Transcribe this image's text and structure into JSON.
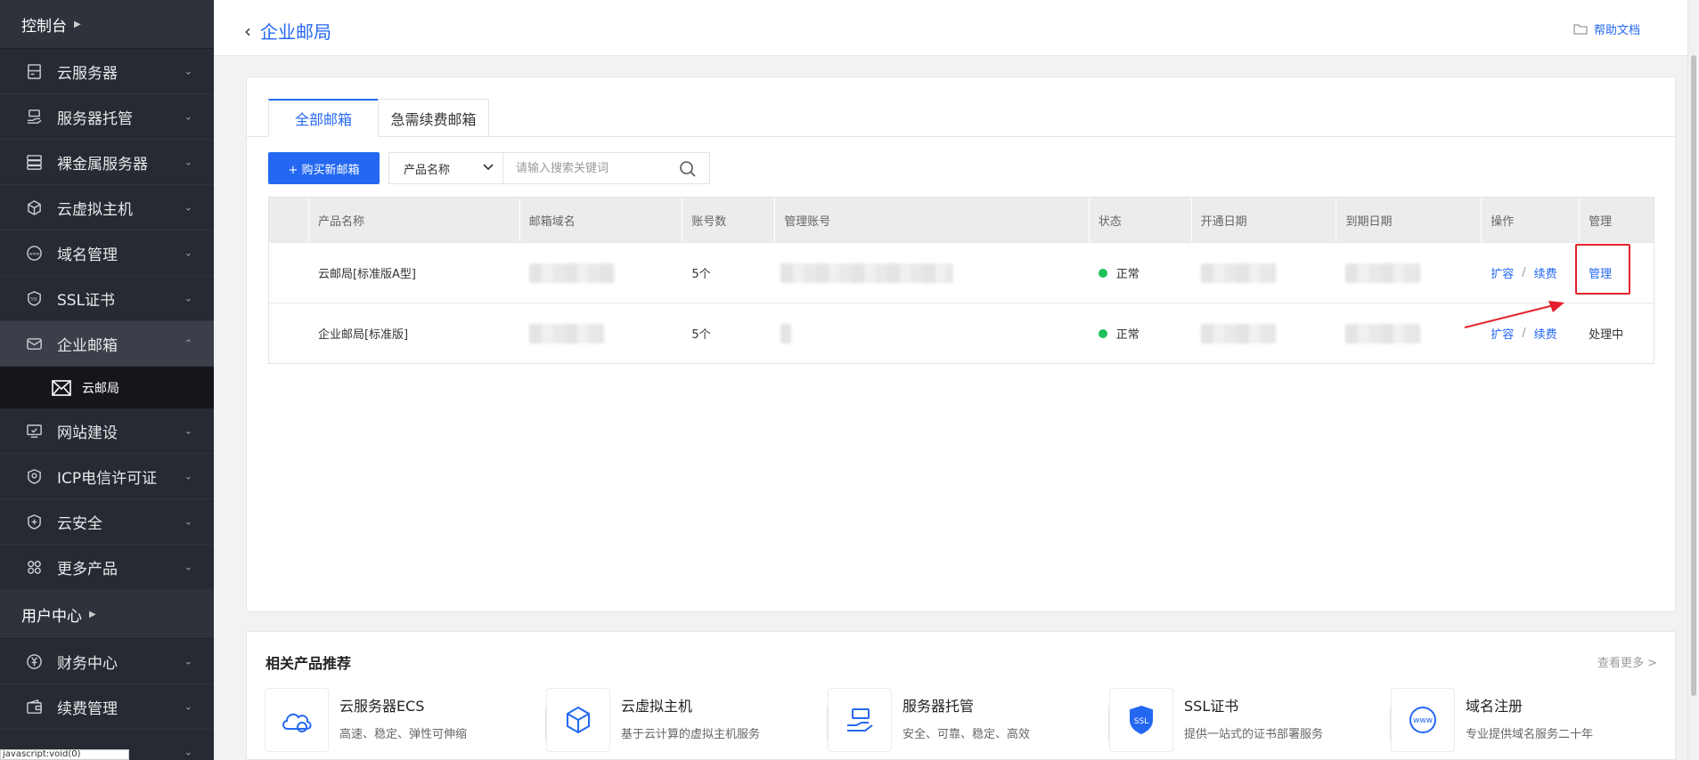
{
  "sidebar": {
    "console_label": "控制台",
    "items": [
      {
        "label": "云服务器",
        "icon": "server-icon"
      },
      {
        "label": "服务器托管",
        "icon": "hosting-icon"
      },
      {
        "label": "裸金属服务器",
        "icon": "bare-metal-icon"
      },
      {
        "label": "云虚拟主机",
        "icon": "cube-icon"
      },
      {
        "label": "域名管理",
        "icon": "www-icon"
      },
      {
        "label": "SSL证书",
        "icon": "ssl-icon"
      },
      {
        "label": "企业邮箱",
        "icon": "mail-icon"
      }
    ],
    "sub_item": {
      "label": "云邮局",
      "icon": "mail-icon"
    },
    "items2": [
      {
        "label": "网站建设",
        "icon": "website-icon"
      },
      {
        "label": "ICP电信许可证",
        "icon": "license-icon"
      },
      {
        "label": "云安全",
        "icon": "shield-icon"
      },
      {
        "label": "更多产品",
        "icon": "grid-icon"
      }
    ],
    "user_center_label": "用户中心",
    "items3": [
      {
        "label": "财务中心",
        "icon": "yen-icon"
      },
      {
        "label": "续费管理",
        "icon": "wallet-icon"
      }
    ],
    "status_tip": "javascript:void(0)"
  },
  "header": {
    "title": "企业邮局",
    "help_label": "帮助文档"
  },
  "tabs": [
    "全部邮箱",
    "急需续费邮箱"
  ],
  "toolbar": {
    "buy_label": "+ 购买新邮箱",
    "filter_label": "产品名称",
    "search_placeholder": "请输入搜索关键词"
  },
  "table": {
    "columns": [
      "产品名称",
      "邮箱域名",
      "账号数",
      "管理账号",
      "状态",
      "开通日期",
      "到期日期",
      "操作",
      "管理"
    ],
    "rows": [
      {
        "product": "云邮局[标准版A型]",
        "accounts": "5个",
        "status": "正常",
        "op_expand": "扩容",
        "op_renew": "续费",
        "manage": "管理"
      },
      {
        "product": "企业邮局[标准版]",
        "accounts": "5个",
        "status": "正常",
        "op_expand": "扩容",
        "op_renew": "续费",
        "manage": "处理中"
      }
    ],
    "op_separator": "/"
  },
  "recommend": {
    "title": "相关产品推荐",
    "more_label": "查看更多 >",
    "items": [
      {
        "name": "云服务器ECS",
        "desc": "高速、稳定、弹性可伸缩",
        "icon": "cloud-icon"
      },
      {
        "name": "云虚拟主机",
        "desc": "基于云计算的虚拟主机服务",
        "icon": "cube-icon"
      },
      {
        "name": "服务器托管",
        "desc": "安全、可靠、稳定、高效",
        "icon": "hosting-icon"
      },
      {
        "name": "SSL证书",
        "desc": "提供一站式的证书部署服务",
        "icon": "ssl-icon"
      },
      {
        "name": "域名注册",
        "desc": "专业提供域名服务二十年",
        "icon": "www-icon"
      }
    ]
  },
  "colors": {
    "primary": "#2468f2",
    "sidebar_bg": "#262a33",
    "status_ok": "#1ec15a",
    "highlight": "#e5202c"
  }
}
